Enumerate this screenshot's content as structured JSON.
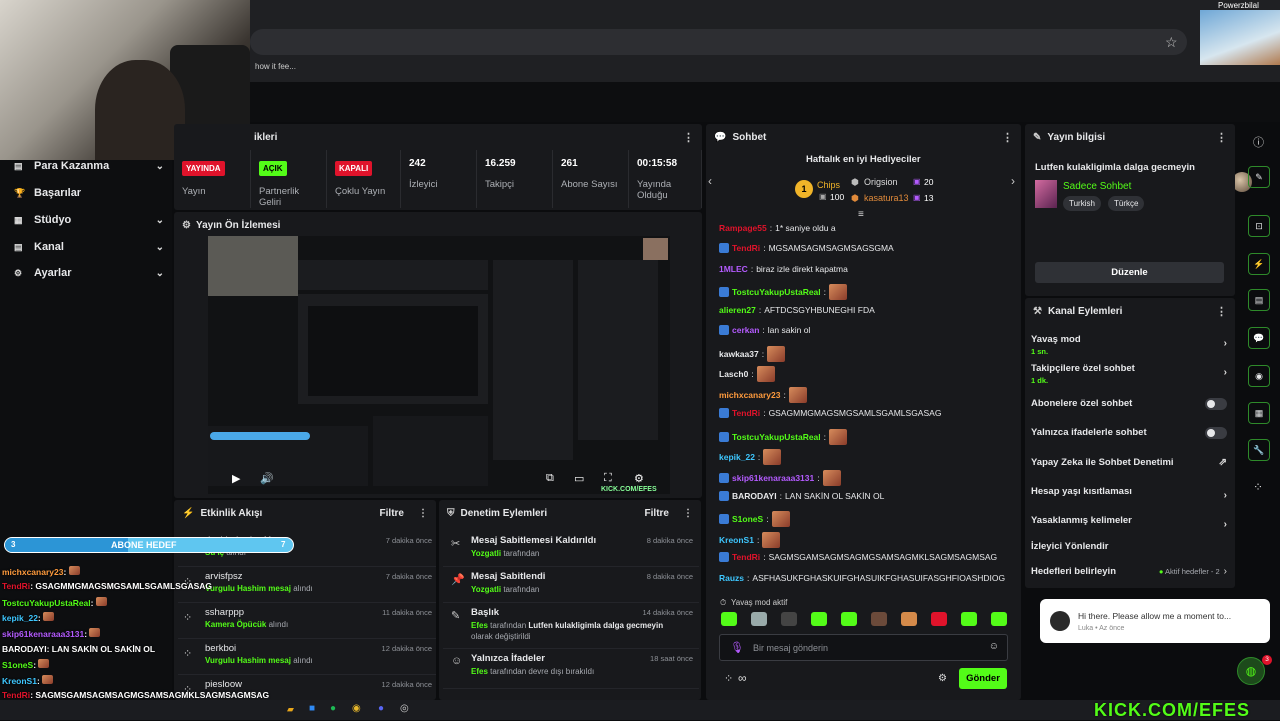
{
  "browser": {
    "bookmark": "how it fee..."
  },
  "webcam_pip": {
    "name": "Powerzbilal"
  },
  "nav": [
    {
      "label": "Para Kazanma",
      "chev": true
    },
    {
      "label": "Başarılar",
      "chev": false
    },
    {
      "label": "Stüdyo",
      "chev": true
    },
    {
      "label": "Kanal",
      "chev": true
    },
    {
      "label": "Ayarlar",
      "chev": true
    }
  ],
  "stats_panel": {
    "title_fragment": "ikleri"
  },
  "stats": [
    {
      "badge": "YAYINDA",
      "badge_color": "#e0132b",
      "label": "Yayın"
    },
    {
      "badge": "AÇIK",
      "badge_color": "#53fc18",
      "label": "Partnerlik Geliri"
    },
    {
      "badge": "KAPALI",
      "badge_color": "#e0132b",
      "label": "Çoklu Yayın"
    },
    {
      "value": "242",
      "label": "İzleyici"
    },
    {
      "value": "16.259",
      "label": "Takipçi"
    },
    {
      "value": "261",
      "label": "Abone Sayısı"
    },
    {
      "value": "00:15:58",
      "label": "Yayında Olduğu"
    }
  ],
  "preview": {
    "title": "Yayın Ön İzlemesi",
    "watermark": "KICK.COM/EFES"
  },
  "activity": {
    "title": "Etkinlik Akışı",
    "filter": "Filtre",
    "items": [
      {
        "user": "davidoriordan11",
        "action": "Su iç",
        "suffix": "alındı",
        "time": "7 dakika önce"
      },
      {
        "user": "arvisfpsz",
        "action": "Vurgulu Hashim mesaj",
        "suffix": "alındı",
        "time": "7 dakika önce"
      },
      {
        "user": "ssharppp",
        "action": "Kamera Öpücük",
        "suffix": "alındı",
        "time": "11 dakika önce"
      },
      {
        "user": "berkboi",
        "action": "Vurgulu Hashim mesaj",
        "suffix": "alındı",
        "time": "12 dakika önce"
      },
      {
        "user": "piesloow",
        "action": "",
        "suffix": "",
        "time": "12 dakika önce"
      }
    ]
  },
  "moderation": {
    "title": "Denetim Eylemleri",
    "filter": "Filtre",
    "items": [
      {
        "head": "Mesaj Sabitlemesi Kaldırıldı",
        "actor": "Yozgatli",
        "detail": "tarafından",
        "time": "8 dakika önce"
      },
      {
        "head": "Mesaj Sabitlendi",
        "actor": "Yozgatli",
        "detail": "tarafından",
        "time": "8 dakika önce"
      },
      {
        "head": "Başlık",
        "actor": "Efes",
        "detail": "tarafından",
        "detail_bold": "Lutfen kulakligimla dalga gecmeyin",
        "detail_tail": "olarak değiştirildi",
        "time": "14 dakika önce"
      },
      {
        "head": "Yalnızca İfadeler",
        "actor": "Efes",
        "detail": "tarafından devre dışı bırakıldı",
        "time": "18 saat önce"
      }
    ]
  },
  "chat": {
    "title": "Sohbet",
    "gifters_title": "Haftalık en iyi Hediyeciler",
    "gifters": [
      {
        "rank": "1",
        "name": "Chips",
        "amount": "100"
      },
      {
        "rank": "",
        "name": "Origsion",
        "amount": "20"
      },
      {
        "rank": "",
        "name": "kasatura13",
        "amount": "13"
      }
    ],
    "messages": [
      {
        "user": "Rampage55",
        "color": "#e0132b",
        "text": "1* saniye oldu a",
        "badge": false,
        "emote": false
      },
      {
        "user": "TendRi",
        "color": "#e0132b",
        "text": "MGSAMSAGMSAGMSAGSGMA",
        "badge": true,
        "emote": false
      },
      {
        "user": "1MLEC",
        "color": "#b45bff",
        "text": "biraz izle direkt kapatma",
        "badge": false,
        "emote": false
      },
      {
        "user": "TostcuYakupUstaReal",
        "color": "#53fc18",
        "text": "",
        "badge": true,
        "emote": true
      },
      {
        "user": "alieren27",
        "color": "#53fc18",
        "text": "AFTDCSGYHBUNEGHI FDA",
        "badge": false,
        "emote": false
      },
      {
        "user": "cerkan",
        "color": "#b45bff",
        "text": "lan sakin ol",
        "badge": true,
        "emote": false
      },
      {
        "user": "kawkaa37",
        "color": "#e7e8ea",
        "text": "",
        "badge": false,
        "emote": true
      },
      {
        "user": "Lasch0",
        "color": "#e7e8ea",
        "text": "",
        "badge": false,
        "emote": true
      },
      {
        "user": "michxcanary23",
        "color": "#ff9b3d",
        "text": "",
        "badge": false,
        "emote": true
      },
      {
        "user": "TendRi",
        "color": "#e0132b",
        "text": "GSAGMMGMAGSMGSAMLSGAMLSGASAG",
        "badge": true,
        "emote": false
      },
      {
        "user": "TostcuYakupUstaReal",
        "color": "#53fc18",
        "text": "",
        "badge": true,
        "emote": true
      },
      {
        "user": "kepik_22",
        "color": "#3ec7ff",
        "text": "",
        "badge": false,
        "emote": true
      },
      {
        "user": "skip61kenaraaa3131",
        "color": "#b45bff",
        "text": "",
        "badge": true,
        "emote": true
      },
      {
        "user": "BARODAYI",
        "color": "#e7e8ea",
        "text": "LAN SAKİN OL SAKİN OL",
        "badge": true,
        "emote": false
      },
      {
        "user": "S1oneS",
        "color": "#53fc18",
        "text": "",
        "badge": true,
        "emote": true
      },
      {
        "user": "KreonS1",
        "color": "#3ec7ff",
        "text": "",
        "badge": false,
        "emote": true
      },
      {
        "user": "TendRi",
        "color": "#e0132b",
        "text": "SAGMSGAMSAGMSAGMGSAMSAGMKLSAGMSAGMSAG",
        "badge": true,
        "emote": false
      },
      {
        "user": "Rauzs",
        "color": "#3ec7ff",
        "text": "ASFHASUKFGHASKUIFGHASUIKFGHASUIFASGHFIOASHDIOG",
        "badge": false,
        "emote": false
      }
    ],
    "slow_mode_notice": "Yavaş mod aktif",
    "input_placeholder": "Bir mesaj gönderin",
    "send": "Gönder"
  },
  "stream_info": {
    "title": "Yayın bilgisi",
    "stream_title": "Lutfen kulakligimla dalga gecmeyin",
    "category": "Sadece Sohbet",
    "tags": [
      "Turkish",
      "Türkçe"
    ],
    "edit": "Düzenle"
  },
  "channel_actions": {
    "title": "Kanal Eylemleri",
    "rows": [
      {
        "label": "Yavaş mod",
        "sub": "1 sn.",
        "kind": "chev"
      },
      {
        "label": "Takipçilere özel sohbet",
        "sub": "1 dk.",
        "kind": "chev"
      },
      {
        "label": "Abonelere özel sohbet",
        "sub": "",
        "kind": "toggle"
      },
      {
        "label": "Yalnızca ifadelerle sohbet",
        "sub": "",
        "kind": "toggle"
      },
      {
        "label": "Yapay Zeka ile Sohbet Denetimi",
        "sub": "",
        "kind": "ext"
      },
      {
        "label": "Hesap yaşı kısıtlaması",
        "sub": "",
        "kind": "chev"
      },
      {
        "label": "Yasaklanmış kelimeler",
        "sub": "",
        "kind": "chev"
      },
      {
        "label": "İzleyici Yönlendir",
        "sub": "",
        "kind": "none"
      },
      {
        "label": "Hedefleri belirleyin",
        "sub": "",
        "kind": "goal",
        "extra": "Aktif hedefler - 2"
      }
    ]
  },
  "support_popup": {
    "message": "Hi there. Please allow me a moment to...",
    "meta": "Luka • Az önce",
    "badge": "3"
  },
  "overlay": {
    "goal_count": "3",
    "goal_label": "ABONE HEDEF",
    "goal_target": "7",
    "chat": [
      {
        "user": "michxcanary23",
        "text": ""
      },
      {
        "user": "TendRi",
        "text": "GSAGMMGMAGSMGSAMLSGAMLSGASAG"
      },
      {
        "user": "TostcuYakupUstaReal",
        "text": ""
      },
      {
        "user": "kepik_22",
        "text": ""
      },
      {
        "user": "skip61kenaraaa3131",
        "text": ""
      },
      {
        "user": "BARODAYI",
        "text": "LAN SAKİN OL SAKİN OL"
      },
      {
        "user": "S1oneS",
        "text": ""
      },
      {
        "user": "KreonS1",
        "text": ""
      },
      {
        "user": "TendRi",
        "text": "SAGMSGAMSAGMSAGMGSAMSAGMKLSAGMSAGMSAG"
      },
      {
        "user": "Rauzs",
        "text": "ASFHASUKFGHASKUIFGHASUIKFGHASUIFASGHFIOASHDIOG"
      }
    ],
    "brand": "KICK.COM/EFES"
  }
}
